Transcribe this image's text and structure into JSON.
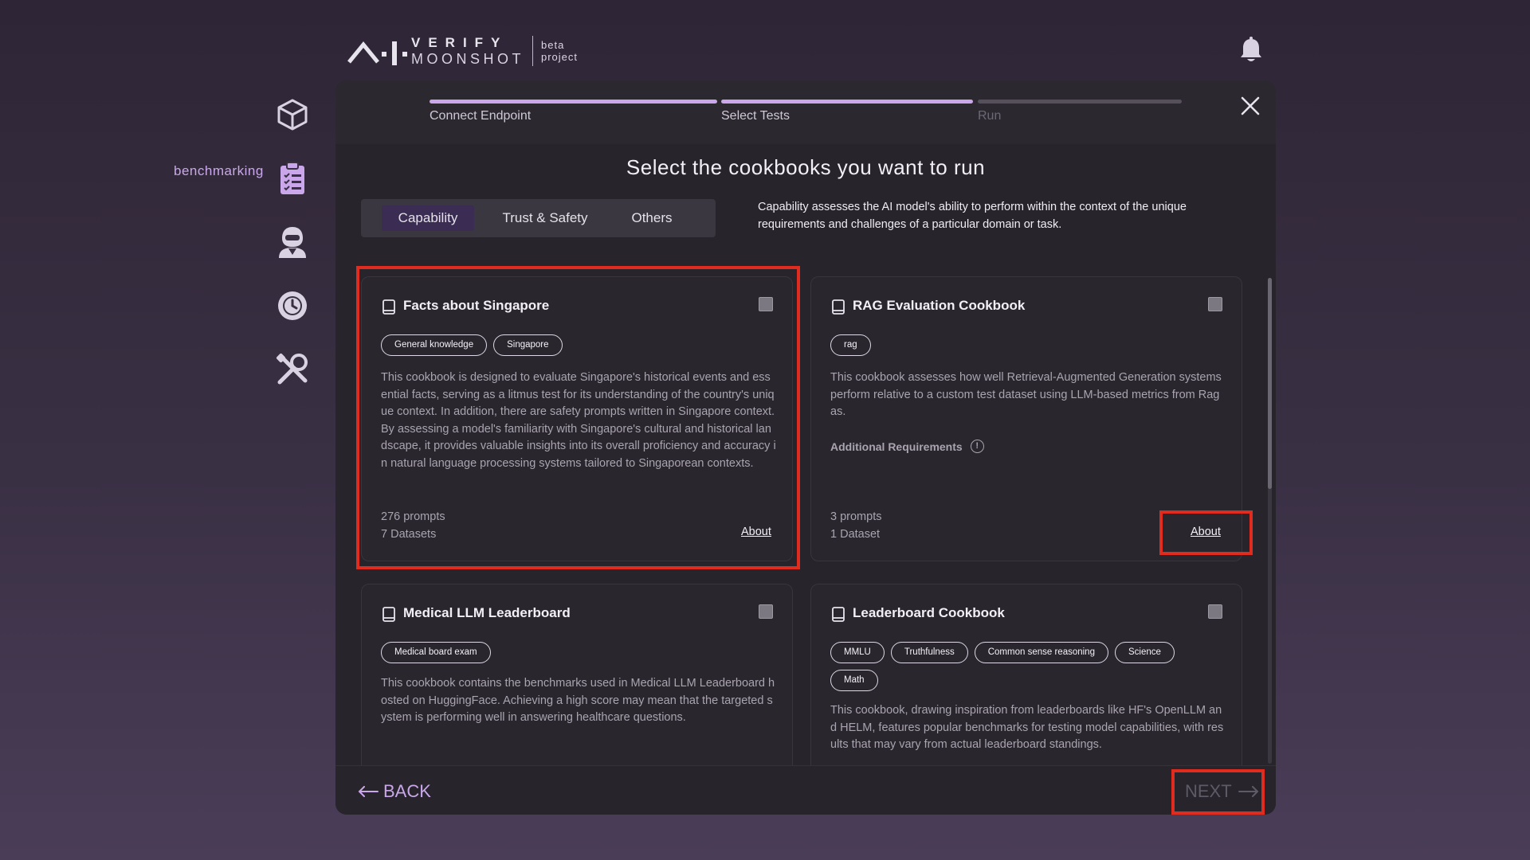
{
  "header": {
    "logo_verify": "VERIFY",
    "logo_moonshot": "MOONSHOT",
    "logo_tag_line1": "beta",
    "logo_tag_line2": "project"
  },
  "sidebar": {
    "items": [
      {
        "icon": "cube-icon"
      },
      {
        "icon": "clipboard-list-icon",
        "label": "benchmarking"
      },
      {
        "icon": "agent-icon"
      },
      {
        "icon": "history-icon"
      },
      {
        "icon": "tools-icon"
      }
    ]
  },
  "wizard": {
    "steps": [
      {
        "label": "Connect Endpoint",
        "status": "complete"
      },
      {
        "label": "Select Tests",
        "status": "current"
      },
      {
        "label": "Run",
        "status": "pending"
      }
    ]
  },
  "page": {
    "title": "Select the cookbooks you want to run"
  },
  "tabs": {
    "items": [
      "Capability",
      "Trust & Safety",
      "Others"
    ],
    "active": "Capability",
    "description": "Capability assesses the AI model's ability to perform within the context of the unique requirements and challenges of a particular domain or task."
  },
  "cookbooks": [
    {
      "title": "Facts about Singapore",
      "tags": [
        "General knowledge",
        "Singapore"
      ],
      "description": "This cookbook is designed to evaluate Singapore's historical events and essential facts, serving as a litmus test for its understanding of the country's unique context. In addition, there are safety prompts written in Singapore context. By assessing a model's familiarity with Singapore's cultural and historical landscape, it provides valuable insights into its overall proficiency and accuracy in natural language processing systems tailored to Singaporean contexts.",
      "prompts": "276 prompts",
      "datasets": "7 Datasets",
      "about_label": "About"
    },
    {
      "title": "RAG Evaluation Cookbook",
      "tags": [
        "rag"
      ],
      "description": "This cookbook assesses how well Retrieval-Augmented Generation systems perform relative to a custom test dataset using LLM-based metrics from Ragas.",
      "additional_requirements": "Additional Requirements",
      "prompts": "3 prompts",
      "datasets": "1 Dataset",
      "about_label": "About"
    },
    {
      "title": "Medical LLM Leaderboard",
      "tags": [
        "Medical board exam"
      ],
      "description": "This cookbook contains the benchmarks used in Medical LLM Leaderboard hosted on HuggingFace. Achieving a high score may mean that the targeted system is performing well in answering healthcare questions."
    },
    {
      "title": "Leaderboard Cookbook",
      "tags": [
        "MMLU",
        "Truthfulness",
        "Common sense reasoning",
        "Science",
        "Math"
      ],
      "description": "This cookbook, drawing inspiration from leaderboards like HF's OpenLLM and HELM, features popular benchmarks for testing model capabilities, with results that may vary from actual leaderboard standings."
    }
  ],
  "footer": {
    "back_label": "BACK",
    "next_label": "NEXT"
  },
  "colors": {
    "accent": "#c9a7ea",
    "highlight": "#e02b1f",
    "background": "#27242b"
  }
}
